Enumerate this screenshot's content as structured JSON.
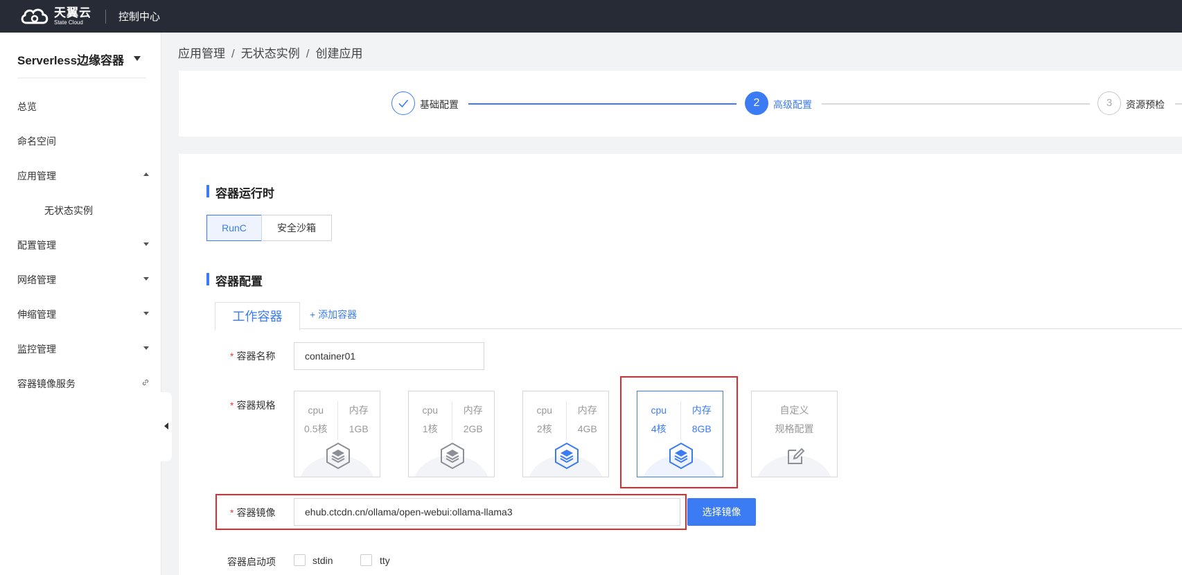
{
  "topbar": {
    "logo_cn": "天翼云",
    "logo_en": "State Cloud",
    "console": "控制中心"
  },
  "sidebar": {
    "product": "Serverless边缘容器",
    "items": [
      {
        "label": "总览"
      },
      {
        "label": "命名空间"
      },
      {
        "label": "应用管理"
      },
      {
        "label": "无状态实例"
      },
      {
        "label": "配置管理"
      },
      {
        "label": "网络管理"
      },
      {
        "label": "伸缩管理"
      },
      {
        "label": "监控管理"
      },
      {
        "label": "容器镜像服务"
      }
    ]
  },
  "breadcrumb": [
    "应用管理",
    "无状态实例",
    "创建应用"
  ],
  "steps": [
    {
      "label": "基础配置",
      "status": "done"
    },
    {
      "label": "高级配置",
      "status": "active",
      "number": "2"
    },
    {
      "label": "资源预检",
      "status": "todo",
      "number": "3"
    }
  ],
  "runtime": {
    "title": "容器运行时",
    "options": [
      "RunC",
      "安全沙箱"
    ],
    "selected": "RunC"
  },
  "container": {
    "title": "容器配置",
    "tab_work": "工作容器",
    "tab_add": "+ 添加容器",
    "name_label": "容器名称",
    "name_value": "container01",
    "spec_label": "容器规格",
    "specs": [
      {
        "cpu_label": "cpu",
        "cpu": "0.5核",
        "mem_label": "内存",
        "mem": "1GB"
      },
      {
        "cpu_label": "cpu",
        "cpu": "1核",
        "mem_label": "内存",
        "mem": "2GB"
      },
      {
        "cpu_label": "cpu",
        "cpu": "2核",
        "mem_label": "内存",
        "mem": "4GB"
      },
      {
        "cpu_label": "cpu",
        "cpu": "4核",
        "mem_label": "内存",
        "mem": "8GB"
      }
    ],
    "selected_spec": 3,
    "custom_line1": "自定义",
    "custom_line2": "规格配置",
    "image_label": "容器镜像",
    "image_value": "ehub.ctcdn.cn/ollama/open-webui:ollama-llama3",
    "image_button": "选择镜像",
    "startup_label": "容器启动项",
    "startup_options": [
      "stdin",
      "tty"
    ]
  },
  "colors": {
    "accent": "#3b7cf5",
    "topbar": "#262b36",
    "highlight": "#e12b2b"
  }
}
